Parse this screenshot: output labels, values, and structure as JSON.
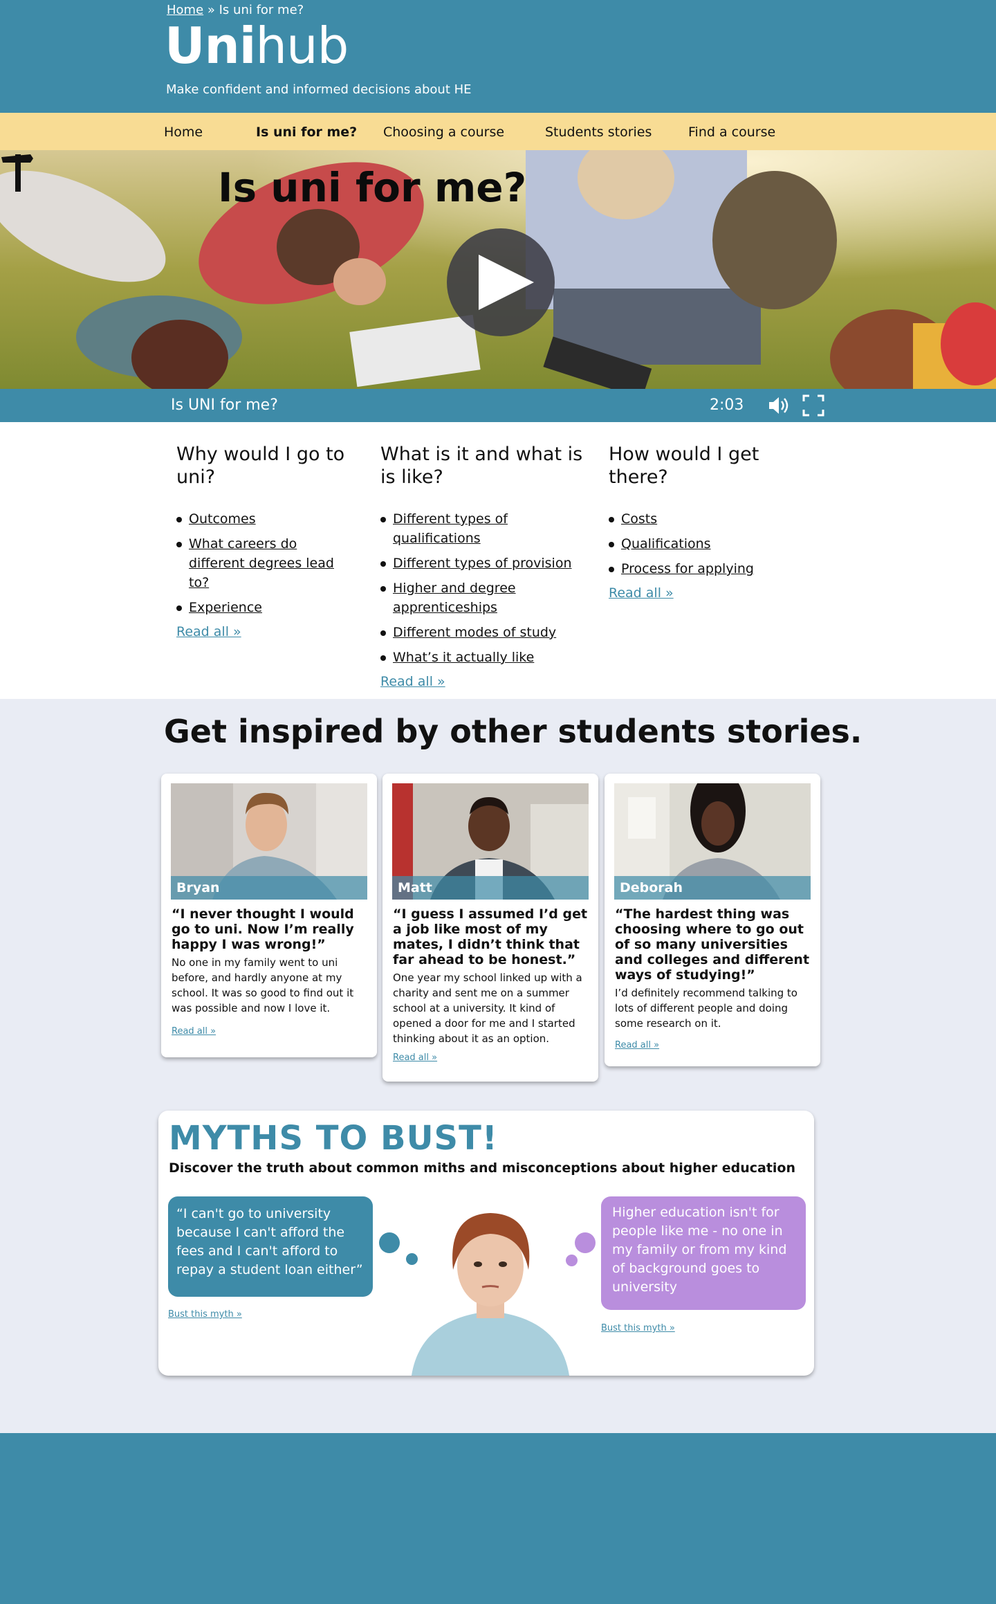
{
  "breadcrumb": {
    "home": "Home",
    "separator": " » ",
    "current": "Is uni for me?"
  },
  "logo": {
    "bold": "Uni",
    "light": "hub"
  },
  "tagline": "Make confident and informed decisions about HE",
  "nav": {
    "items": [
      "Home",
      "Is uni for me?",
      "Choosing a course",
      "Students stories",
      "Find a course"
    ],
    "active": "Is uni for me?"
  },
  "hero": {
    "title": "Is uni for me?",
    "icon": "signpost-icon",
    "play_icon": "play-icon"
  },
  "video": {
    "title": "Is UNI for me?",
    "duration": "2:03",
    "volume_icon": "volume-icon",
    "fullscreen_icon": "fullscreen-icon"
  },
  "columns": [
    {
      "heading": "Why would I go to uni?",
      "links": [
        "Outcomes",
        "What careers do different degrees lead to?",
        "Experience"
      ],
      "read_all": "Read all »"
    },
    {
      "heading": "What is it and what is is like?",
      "links": [
        "Different types of qualifications",
        "Different types of provision",
        "Higher and degree apprenticeships",
        "Different modes of study",
        "What’s it actually like"
      ],
      "read_all": "Read all »"
    },
    {
      "heading": "How would I get there?",
      "links": [
        "Costs",
        "Qualifications",
        "Process for applying"
      ],
      "read_all": "Read all »"
    }
  ],
  "stories": {
    "title": "Get inspired by other students stories.",
    "cards": [
      {
        "name": "Bryan",
        "quote": "“I never thought I would go to uni. Now I’m really happy I was wrong!”",
        "description": "No one in my family went to uni before, and hardly anyone at my school. It was so good to find out it was possible and now I love it.",
        "read_all": "Read all »"
      },
      {
        "name": "Matt",
        "quote": "“I guess I assumed I’d get a job like most of my mates, I didn’t think that far ahead to be honest.”",
        "description": "One year my school linked up with a charity and sent me on a summer school at a university. It kind of opened a door for me and I started thinking about it as an option.",
        "read_all": "Read all »"
      },
      {
        "name": "Deborah",
        "quote": "“The hardest thing was choosing where to go out of so many universities and colleges and different ways of studying!”",
        "description": "I’d definitely recommend talking to lots of different people and doing some research on it.",
        "read_all": "Read all »"
      }
    ]
  },
  "myths": {
    "title": "MYTHS TO BUST!",
    "subtitle": "Discover the truth about common miths and misconceptions about higher education",
    "left_myth": "“I can't go to university because I can't afford the fees and I can't afford to repay a student loan either”",
    "right_myth": "Higher education isn't for people like me - no one in my family or from my kind of background goes to university",
    "bust_label": "Bust this myth »",
    "colors": {
      "left": "#3e8ba8",
      "right": "#b98edd"
    }
  },
  "colors": {
    "brand": "#3e8ba8",
    "nav": "#f8dc94",
    "page_bg": "#e9ecf4"
  }
}
